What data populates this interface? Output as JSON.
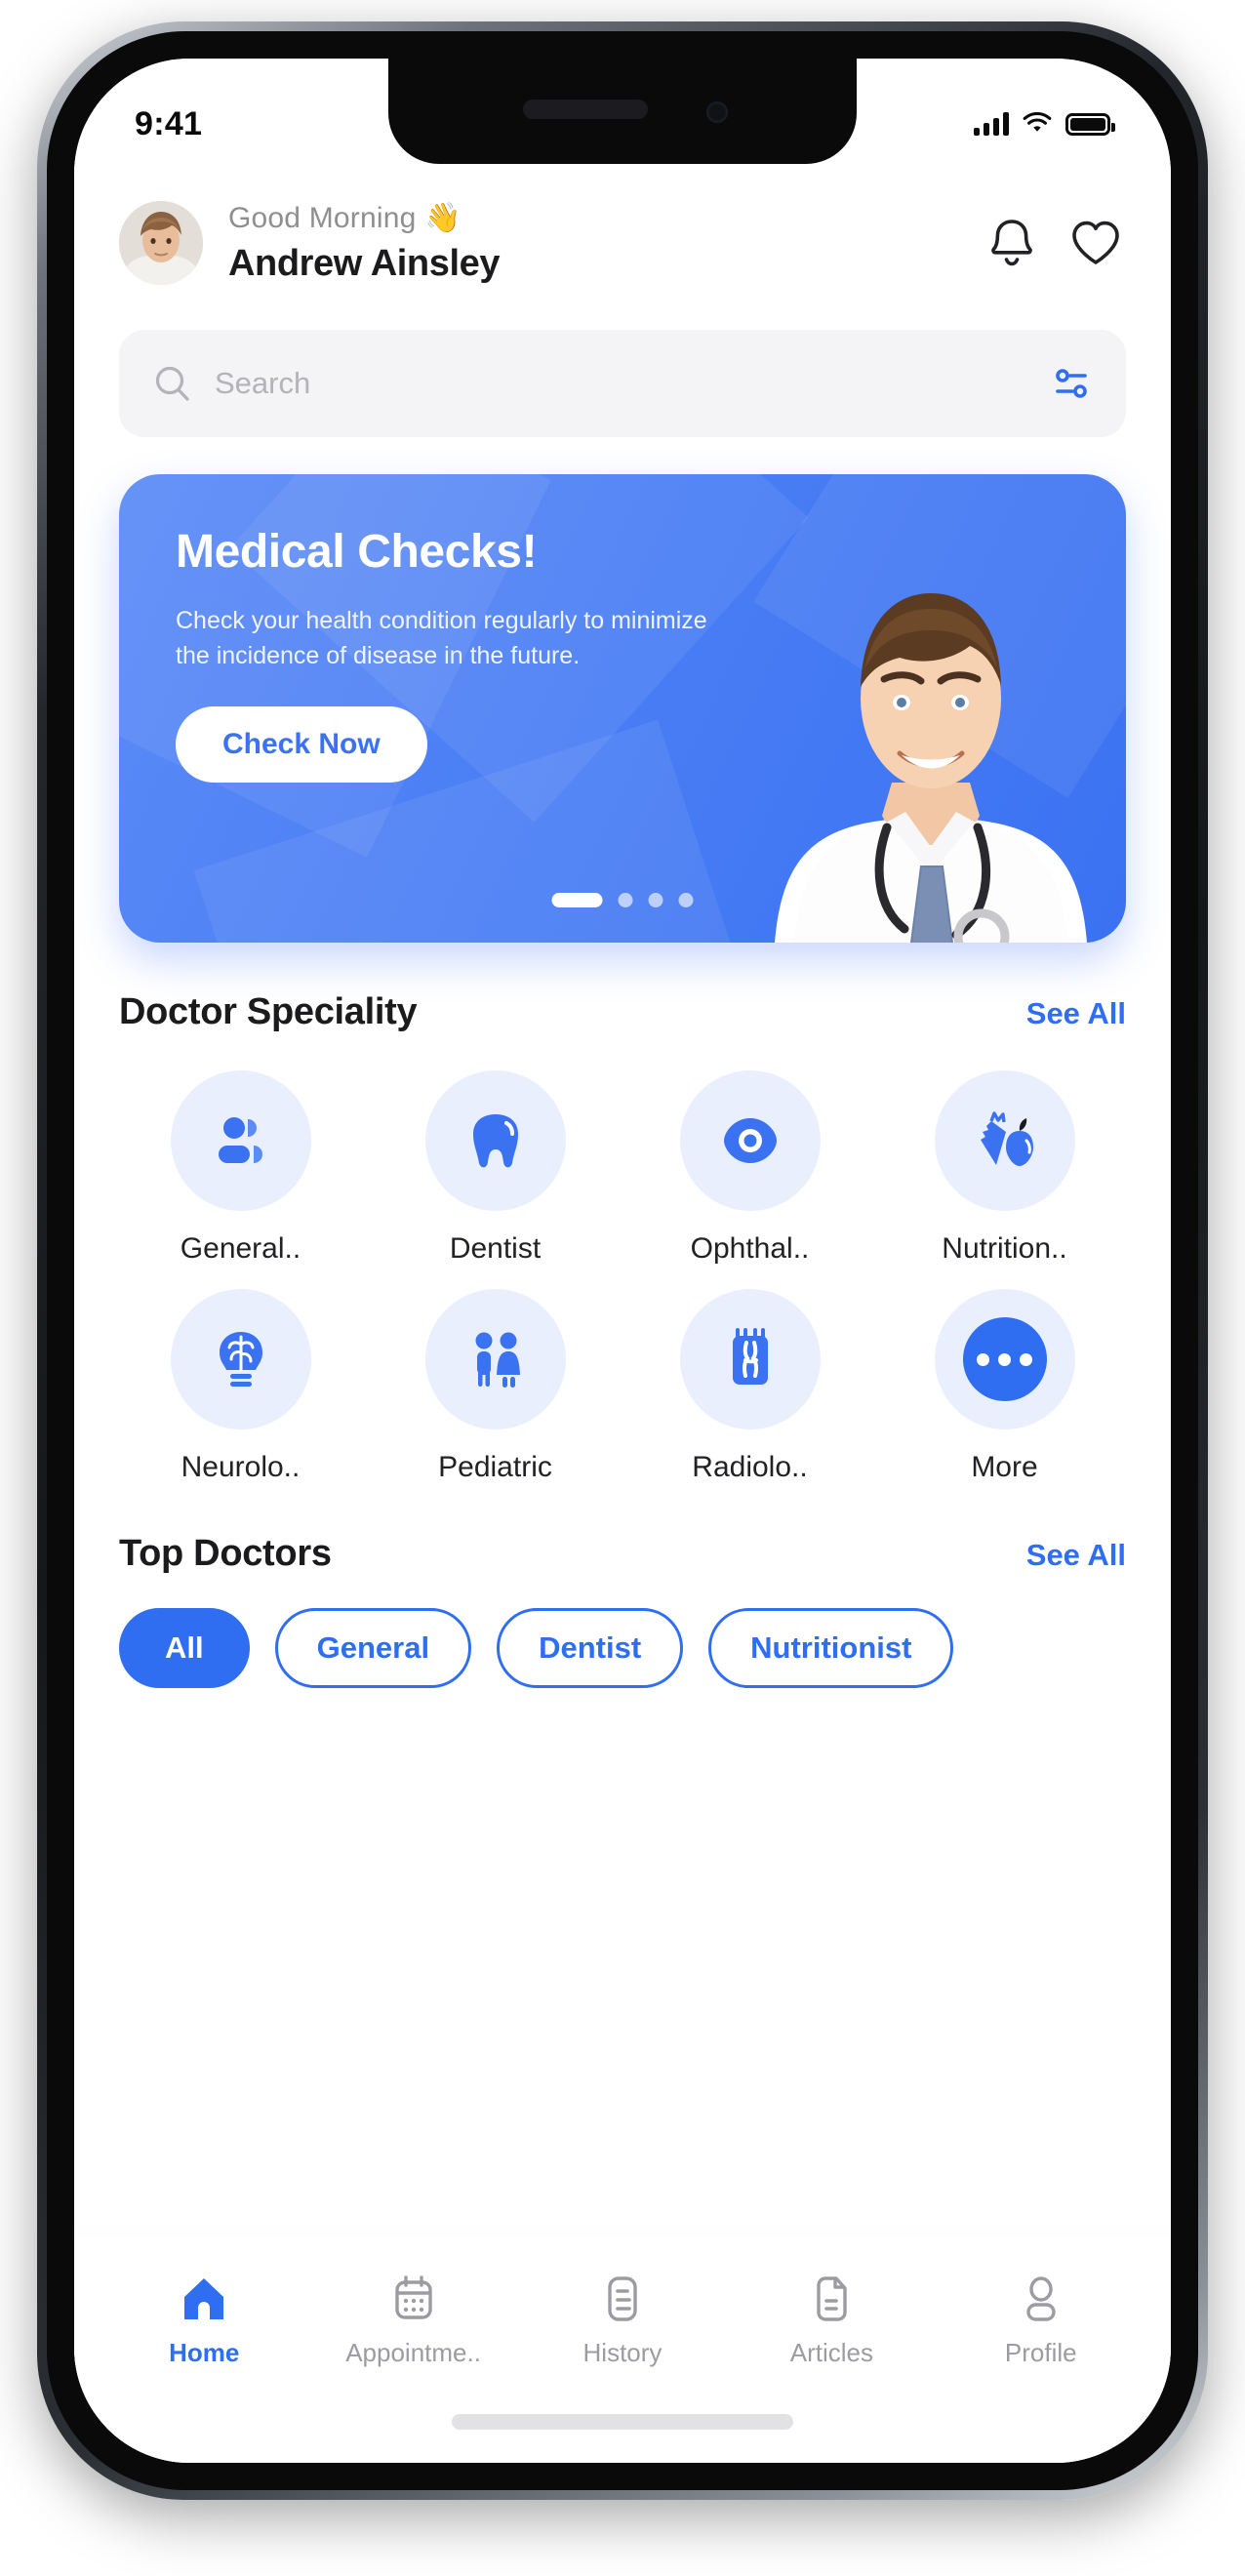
{
  "status_bar": {
    "time": "9:41",
    "signal_icon": "cellular-signal-icon",
    "wifi_icon": "wifi-icon",
    "battery_icon": "battery-icon"
  },
  "header": {
    "greeting": "Good Morning 👋",
    "user_name": "Andrew Ainsley",
    "avatar_name": "user-avatar",
    "notification_icon": "bell-icon",
    "favorite_icon": "heart-icon"
  },
  "search": {
    "placeholder": "Search",
    "search_icon": "search-icon",
    "filter_icon": "filter-sliders-icon"
  },
  "banner": {
    "title": "Medical Checks!",
    "subtitle": "Check your health condition regularly to minimize the incidence of disease in the future.",
    "cta_label": "Check Now",
    "image_name": "doctor-photo",
    "total_dots": 4,
    "active_dot": 1,
    "accent_color": "#3b72f2"
  },
  "speciality": {
    "section_title": "Doctor Speciality",
    "see_all_label": "See All",
    "items": [
      {
        "label": "General..",
        "icon": "general-doctor-icon"
      },
      {
        "label": "Dentist",
        "icon": "tooth-icon"
      },
      {
        "label": "Ophthal..",
        "icon": "eye-icon"
      },
      {
        "label": "Nutrition..",
        "icon": "carrot-apple-icon"
      },
      {
        "label": "Neurolo..",
        "icon": "brain-bulb-icon"
      },
      {
        "label": "Pediatric",
        "icon": "children-icon"
      },
      {
        "label": "Radiolo..",
        "icon": "xray-icon"
      },
      {
        "label": "More",
        "icon": "more-dots-icon"
      }
    ]
  },
  "top_doctors": {
    "section_title": "Top Doctors",
    "see_all_label": "See All",
    "filters": [
      {
        "label": "All",
        "active": true
      },
      {
        "label": "General",
        "active": false
      },
      {
        "label": "Dentist",
        "active": false
      },
      {
        "label": "Nutritionist",
        "active": false
      }
    ]
  },
  "tabbar": {
    "items": [
      {
        "label": "Home",
        "icon": "home-icon",
        "active": true
      },
      {
        "label": "Appointme..",
        "icon": "calendar-icon",
        "active": false
      },
      {
        "label": "History",
        "icon": "history-list-icon",
        "active": false
      },
      {
        "label": "Articles",
        "icon": "article-document-icon",
        "active": false
      },
      {
        "label": "Profile",
        "icon": "person-icon",
        "active": false
      }
    ]
  },
  "colors": {
    "primary": "#2f6ef0",
    "banner_blue": "#3b72f2",
    "muted_text": "#9b9ba2",
    "chip_bg": "#e9effd"
  }
}
